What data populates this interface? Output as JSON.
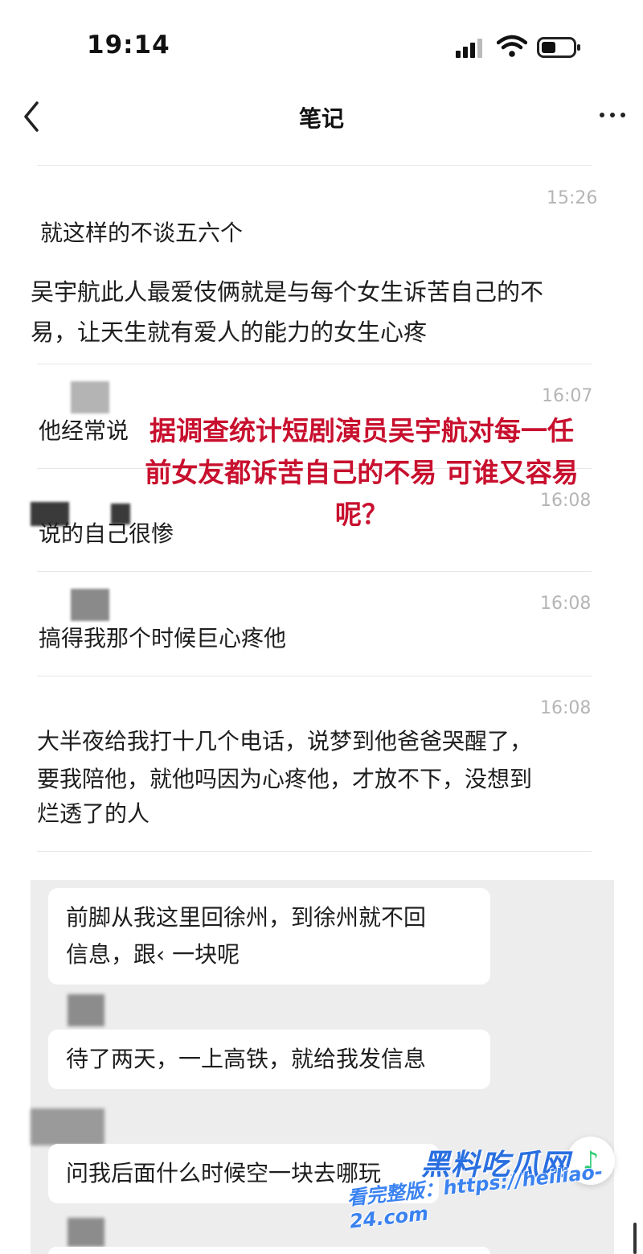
{
  "status_bar": {
    "time": "19:14",
    "icons": [
      "signal-icon",
      "wifi-icon",
      "battery-icon"
    ]
  },
  "header": {
    "title": "笔记",
    "back_icon": "chevron-left-icon",
    "more_icon": "more-horizontal-icon"
  },
  "notes": [
    {
      "time": "15:26",
      "lines": [
        "就这样的不谈五六个"
      ]
    },
    {
      "time": "",
      "lines": [
        "吴宇航此人最爱伎俩就是与每个女生诉苦自己的不",
        "易，让天生就有爱人的能力的女生心疼"
      ]
    },
    {
      "time": "16:07",
      "lines": [
        "他经常说"
      ]
    },
    {
      "time": "16:08",
      "lines": [
        "说的自己很惨"
      ]
    },
    {
      "time": "16:08",
      "lines": [
        "搞得我那个时候巨心疼他"
      ]
    },
    {
      "time": "16:08",
      "lines": [
        "大半夜给我打十几个电话，说梦到他爸爸哭醒了，",
        "要我陪他，就他吗因为心疼他，才放不下，没想到",
        "烂透了的人"
      ]
    }
  ],
  "overlay_caption": [
    "据调查统计短剧演员吴宇航对每一任",
    "前女友都诉苦自己的不易 可谁又容易",
    "呢？"
  ],
  "chat": {
    "bubbles": [
      {
        "lines": [
          "前脚从我这里回徐州，到徐州就不回",
          "信息，跟‹      一块呢"
        ]
      },
      {
        "lines": [
          "待了两天，一上高铁，就给我发信息"
        ]
      },
      {
        "lines": [
          "问我后面什么时候空一块去哪玩"
        ]
      }
    ]
  },
  "music_icon": "music-note-icon",
  "watermark": {
    "logo": "黑料吃瓜网",
    "url": "看完整版：https://heiliao-24.com"
  },
  "colors": {
    "accent_red": "#c8102e",
    "watermark_blue": "#2a6fe0",
    "timestamp_gray": "#b5b5b5",
    "chat_bg": "#ededed"
  }
}
